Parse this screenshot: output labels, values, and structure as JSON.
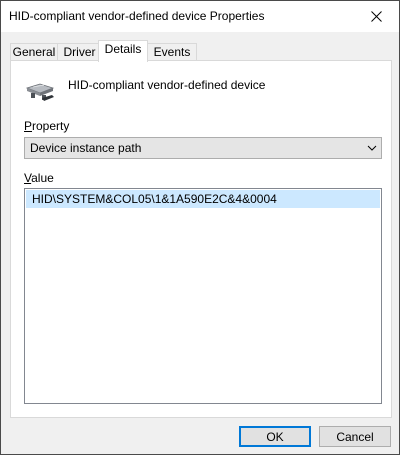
{
  "window": {
    "title": "HID-compliant vendor-defined device Properties"
  },
  "tabs": [
    {
      "label": "General"
    },
    {
      "label": "Driver"
    },
    {
      "label": "Details"
    },
    {
      "label": "Events"
    }
  ],
  "active_tab": "Details",
  "details": {
    "device_name": "HID-compliant vendor-defined device",
    "property_label_first": "P",
    "property_label_rest": "roperty",
    "property_value": "Device instance path",
    "value_label_first": "V",
    "value_label_rest": "alue",
    "values": [
      "HID\\SYSTEM&COL05\\1&1A590E2C&4&0004"
    ]
  },
  "buttons": {
    "ok": "OK",
    "cancel": "Cancel"
  },
  "icons": {
    "close": "close-icon",
    "device": "device-icon",
    "dropdown": "chevron-down-icon"
  }
}
